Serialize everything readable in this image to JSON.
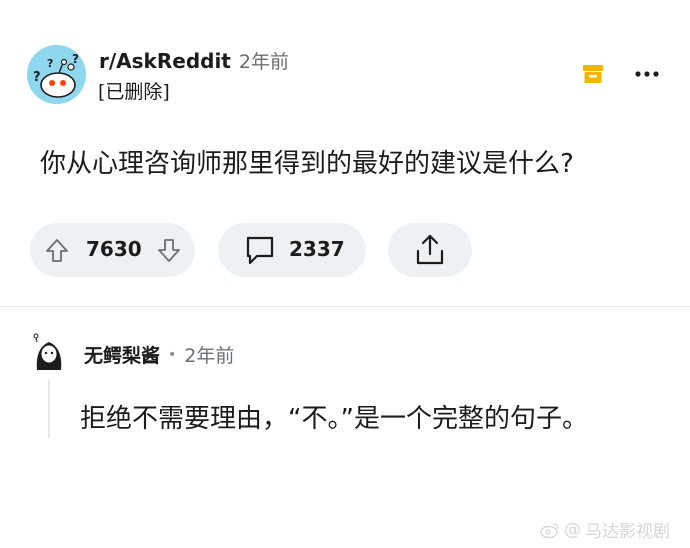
{
  "post": {
    "subreddit": "r/AskReddit",
    "time": "2年前",
    "author": "[已删除]",
    "title": "你从心理咨询师那里得到的最好的建议是什么?",
    "votes": "7630",
    "comments": "2337"
  },
  "comment": {
    "author": "无鳄梨酱",
    "separator": "•",
    "time": "2年前",
    "body": "拒绝不需要理由，“不。”是一个完整的句子。"
  },
  "watermark": {
    "symbol": "@",
    "text": "马达影视剧"
  },
  "colors": {
    "accent_award": "#f4b400",
    "pill_bg": "#eef1f3",
    "subreddit_avatar_bg": "#8fd7ef"
  }
}
